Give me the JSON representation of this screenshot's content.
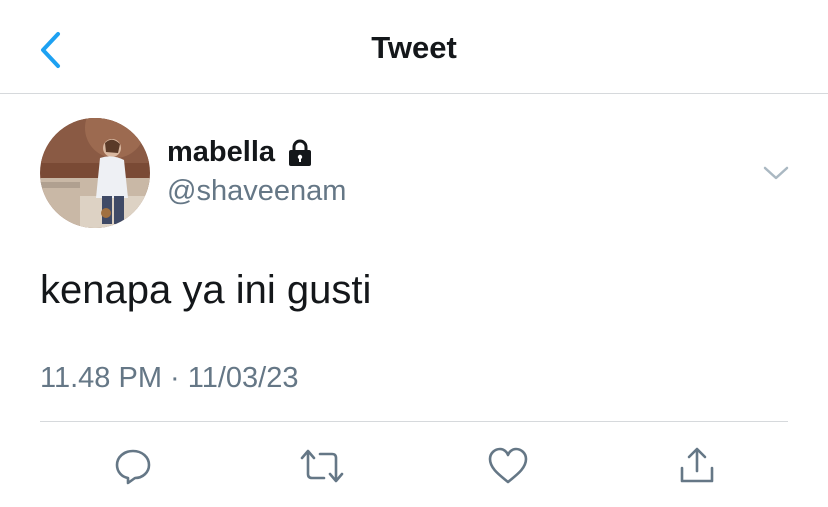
{
  "header": {
    "title": "Tweet",
    "back_icon": "chevron-left-icon",
    "accent_color": "#1da1f2"
  },
  "tweet": {
    "author": {
      "display_name": "mabella",
      "handle": "@shaveenam",
      "protected_icon": "lock-icon",
      "avatar": "avatar-photo"
    },
    "menu_icon": "chevron-down-icon",
    "text": "kenapa ya ini gusti",
    "timestamp": "11.48 PM · 11/03/23"
  },
  "actions": [
    {
      "icon": "reply-icon"
    },
    {
      "icon": "retweet-icon"
    },
    {
      "icon": "like-icon"
    },
    {
      "icon": "share-icon"
    }
  ],
  "colors": {
    "text_primary": "#14171a",
    "text_secondary": "#657786",
    "divider": "#d6d9dc"
  }
}
